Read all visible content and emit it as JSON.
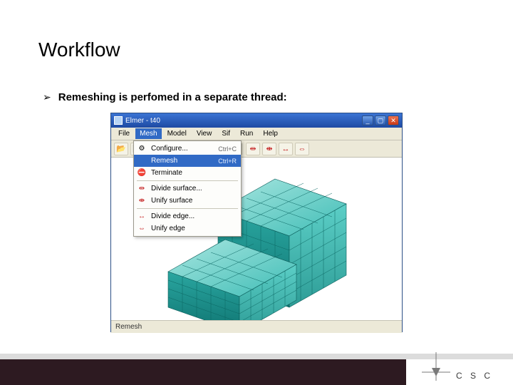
{
  "slide": {
    "title": "Workflow",
    "bullet": "Remeshing is perfomed in a separate thread:"
  },
  "window": {
    "title": "Elmer - t40",
    "menubar": [
      "File",
      "Mesh",
      "Model",
      "View",
      "Sif",
      "Run",
      "Help"
    ],
    "open_menu_index": 1,
    "dropdown": {
      "items": [
        {
          "icon": "gear",
          "label": "Configure...",
          "shortcut": "Ctrl+C"
        },
        {
          "icon": "",
          "label": "Remesh",
          "shortcut": "Ctrl+R",
          "selected": true
        },
        {
          "icon": "stop",
          "label": "Terminate",
          "shortcut": ""
        },
        {
          "sep": true
        },
        {
          "icon": "div",
          "label": "Divide surface...",
          "shortcut": ""
        },
        {
          "icon": "uni",
          "label": "Unify surface",
          "shortcut": ""
        },
        {
          "sep": true
        },
        {
          "icon": "div",
          "label": "Divide edge...",
          "shortcut": ""
        },
        {
          "icon": "uni",
          "label": "Unify edge",
          "shortcut": ""
        }
      ]
    },
    "status": "Remesh"
  },
  "footer": {
    "brand": "C S C"
  }
}
